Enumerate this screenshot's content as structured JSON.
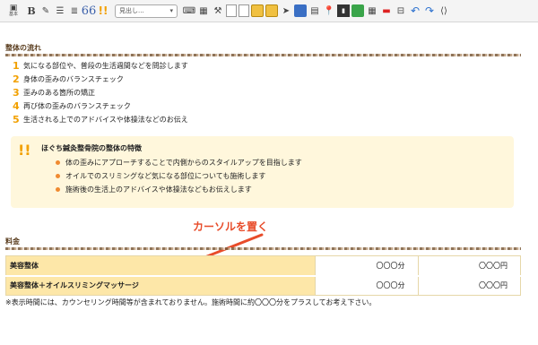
{
  "toolbar": {
    "basic_label": "基本",
    "bold_label": "B",
    "quote_glyph": "66",
    "exclaim_glyph": "!!",
    "heading_select": "見出し..."
  },
  "flow_section": {
    "title": "整体の流れ",
    "steps": [
      {
        "num": "1",
        "text": "気になる部位や、普段の生活週間などを問診します"
      },
      {
        "num": "2",
        "text": "身体の歪みのバランスチェック"
      },
      {
        "num": "3",
        "text": "歪みのある箇所の矯正"
      },
      {
        "num": "4",
        "text": "再び体の歪みのバランスチェック"
      },
      {
        "num": "5",
        "text": "生活される上でのアドバイスや体操法などのお伝え"
      }
    ]
  },
  "feature": {
    "icon": "!!",
    "title": "ほぐち鍼灸整骨院の整体の特徴",
    "items": [
      "体の歪みにアプローチすることで内側からのスタイルアップを目指します",
      "オイルでのスリミングなど気になる部位についても施術します",
      "施術後の生活上のアドバイスや体操法などもお伝えします"
    ]
  },
  "annotation": "カーソルを置く",
  "price_section": {
    "title": "料金",
    "rows": [
      {
        "name": "美容整体",
        "time": "〇〇〇分",
        "price": "〇〇〇円"
      },
      {
        "name": "美容整体＋オイルスリミングマッサージ",
        "time": "〇〇〇分",
        "price": "〇〇〇円"
      }
    ],
    "note": "※表示時間には、カウンセリング時間等が含まれておりません。施術時間に約〇〇〇分をプラスしてお考え下さい。"
  },
  "colors": {
    "accent_orange": "#f2a000",
    "annotation_red": "#e84c2a",
    "price_name_bg": "#fde7a8",
    "feature_bg": "#fff7dc"
  }
}
